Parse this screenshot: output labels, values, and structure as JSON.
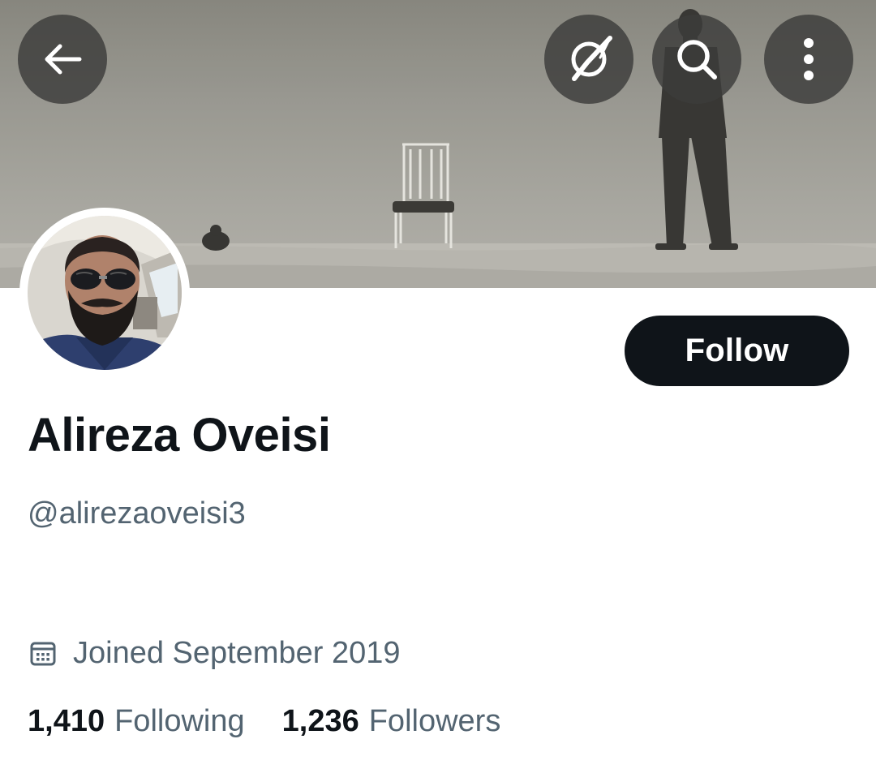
{
  "banner": {
    "description_colors": {
      "sky": "#a09f97",
      "sand": "#b9b7b0"
    }
  },
  "toolbar": {
    "back_icon": "arrow-left-icon",
    "translate_icon": "translate-icon",
    "search_icon": "search-icon",
    "more_icon": "more-vertical-icon"
  },
  "profile": {
    "display_name": "Alireza Oveisi",
    "handle": "@alirezaoveisi3",
    "follow_label": "Follow",
    "joined": "Joined September 2019"
  },
  "stats": {
    "following_count": "1,410",
    "following_label": "Following",
    "followers_count": "1,236",
    "followers_label": "Followers"
  },
  "colors": {
    "primary_text": "#0f1419",
    "secondary_text": "#536471",
    "follow_bg": "#0f1419",
    "follow_text": "#ffffff"
  }
}
